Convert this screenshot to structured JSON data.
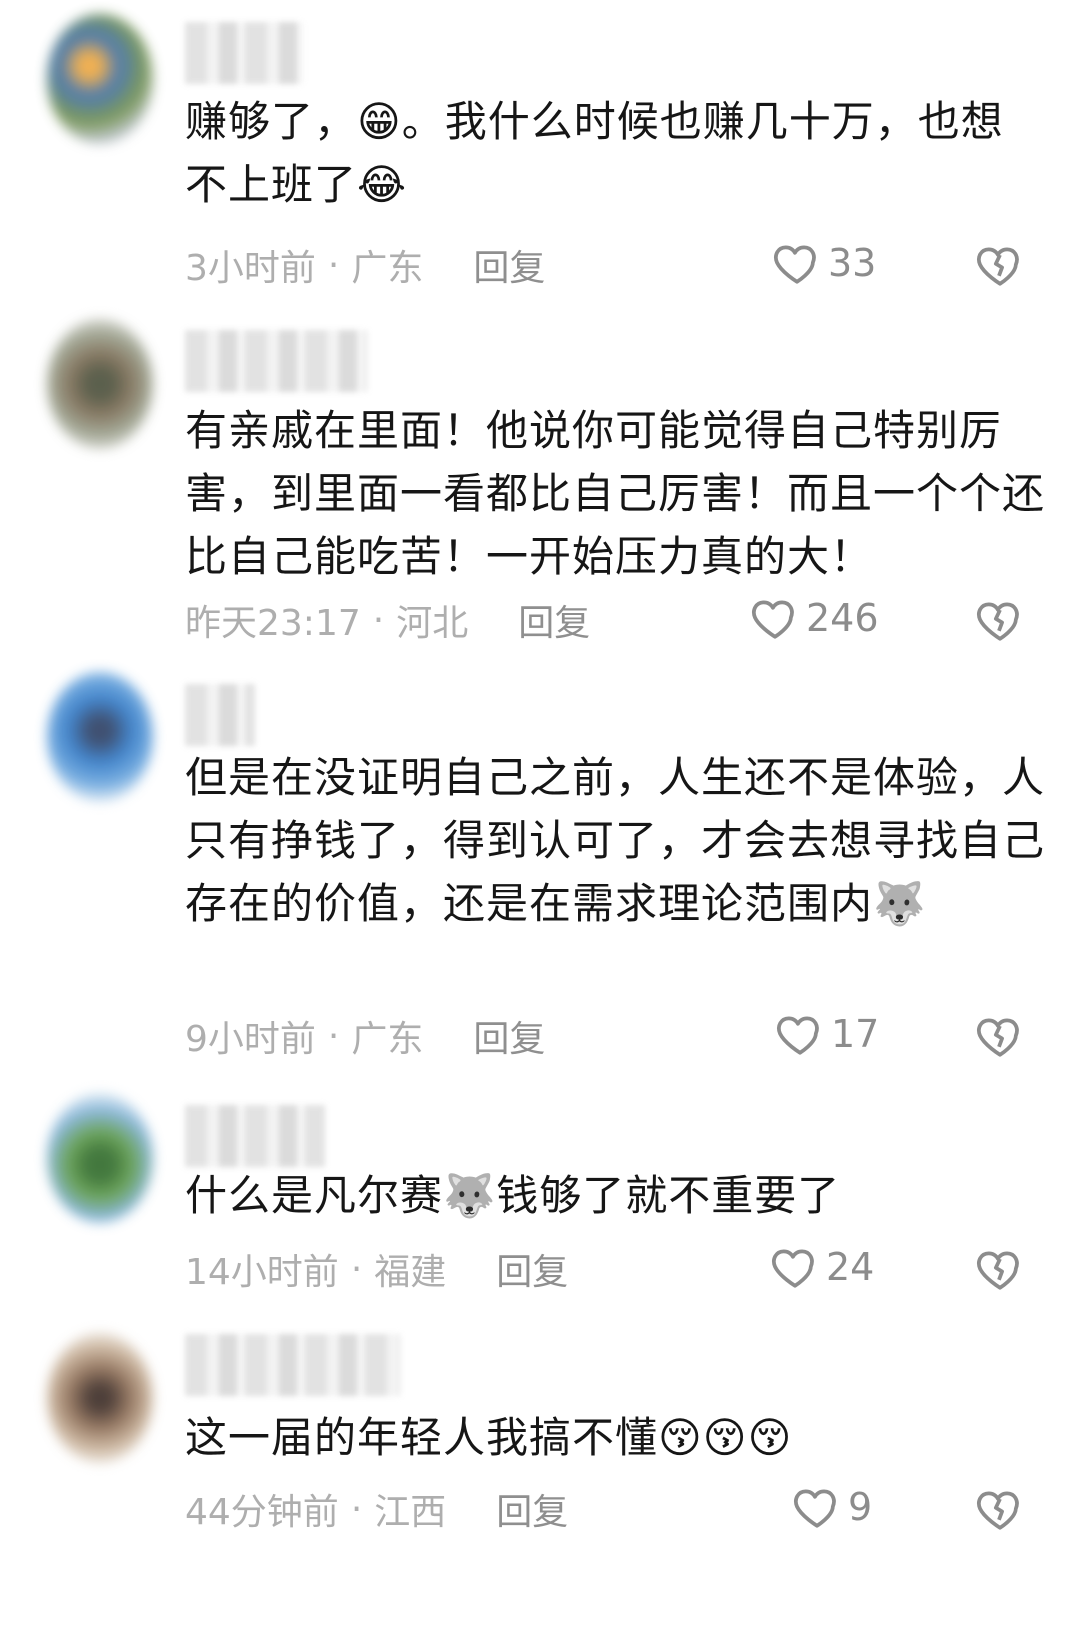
{
  "comments": [
    {
      "text": "赚够了，😁。我什么时候也赚几十万，也想不上班了😂",
      "time": "3小时前",
      "location": "广东",
      "reply_label": "回复",
      "likes": "33",
      "avatar_color": "#5c7aa0"
    },
    {
      "text": "有亲戚在里面！他说你可能觉得自己特别厉害，到里面一看都比自己厉害！而且一个个还比自己能吃苦！一开始压力真的大！",
      "time": "昨天23:17",
      "location": "河北",
      "reply_label": "回复",
      "likes": "246",
      "avatar_color": "#6c7a5e"
    },
    {
      "text": "但是在没证明自己之前，人生还不是体验，人只有挣钱了，得到认可了，才会去想寻找自己存在的价值，还是在需求理论范围内🐺",
      "time": "9小时前",
      "location": "广东",
      "reply_label": "回复",
      "likes": "17",
      "avatar_color": "#3f7dbf"
    },
    {
      "text": "什么是凡尔赛🐺钱够了就不重要了",
      "time": "14小时前",
      "location": "福建",
      "reply_label": "回复",
      "likes": "24",
      "avatar_color": "#4f8a3e"
    },
    {
      "text": "这一届的年轻人我搞不懂😚😚😚",
      "time": "44分钟前",
      "location": "江西",
      "reply_label": "回复",
      "likes": "9",
      "avatar_color": "#7b5a45"
    }
  ],
  "icons": {
    "like": "heart-outline-icon",
    "dislike": "broken-heart-icon"
  },
  "colors": {
    "text": "#161616",
    "meta": "#aeaeae",
    "icon": "#8c8c8c"
  }
}
